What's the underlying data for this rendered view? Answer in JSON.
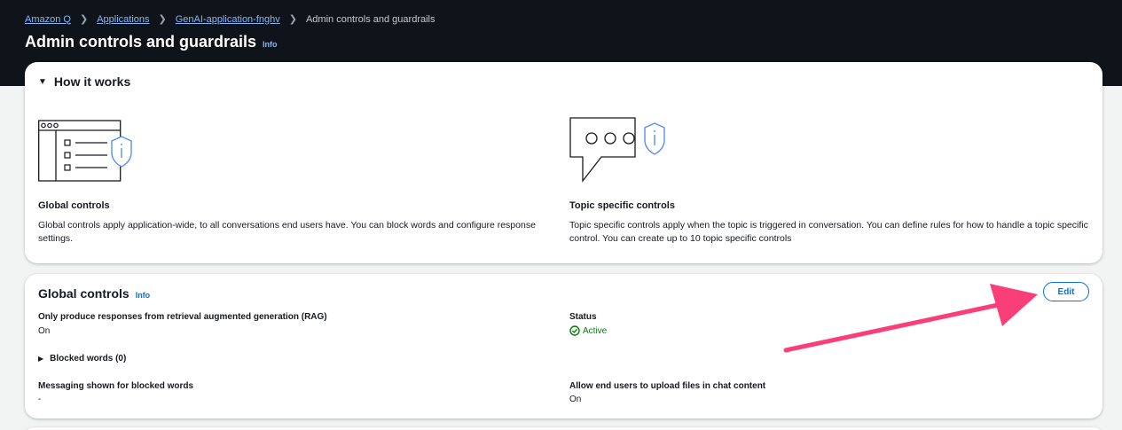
{
  "breadcrumb": {
    "items": [
      "Amazon Q",
      "Applications",
      "GenAI-application-fnghv"
    ],
    "current": "Admin controls and guardrails"
  },
  "page": {
    "title": "Admin controls and guardrails",
    "info": "Info"
  },
  "how_it_works": {
    "header": "How it works",
    "global": {
      "title": "Global controls",
      "description": "Global controls apply application-wide, to all conversations end users have. You can block words and configure response settings."
    },
    "topic": {
      "title": "Topic specific controls",
      "description": "Topic specific controls apply when the topic is triggered in conversation. You can define rules for how to handle a topic specific control. You can create up to 10 topic specific controls"
    }
  },
  "global_controls": {
    "title": "Global controls",
    "info": "Info",
    "edit_label": "Edit",
    "rag_label": "Only produce responses from retrieval augmented generation (RAG)",
    "rag_value": "On",
    "status_label": "Status",
    "status_value": "Active",
    "blocked_words": "Blocked words (0)",
    "messaging_label": "Messaging shown for blocked words",
    "messaging_value": "-",
    "upload_label": "Allow end users to upload files in chat content",
    "upload_value": "On"
  },
  "colors": {
    "header_bg": "#0f141a",
    "link": "#0972d3",
    "success": "#037f0c",
    "annotation_arrow": "#fa3f78",
    "illustration_accent": "#5a8ff0"
  },
  "icons": [
    "chevron-right-icon",
    "caret-down-icon",
    "caret-right-icon",
    "check-circle-icon",
    "shield-icon",
    "window-list-icon",
    "chat-bubble-icon"
  ]
}
